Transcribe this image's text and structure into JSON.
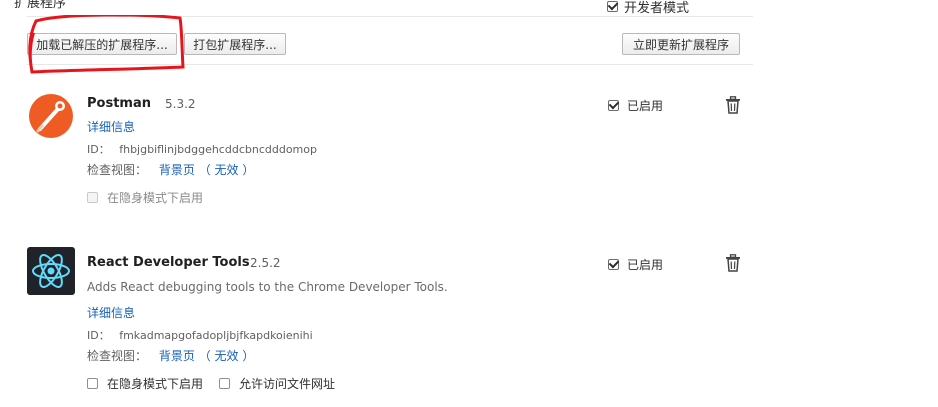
{
  "header": {
    "title": "扩展程序",
    "developer_mode_label": "开发者模式",
    "developer_mode_checked": true
  },
  "toolbar": {
    "load_unpacked_label": "加载已解压的扩展程序...",
    "pack_label": "打包扩展程序...",
    "update_label": "立即更新扩展程序"
  },
  "colors": {
    "annotation": "#e8141b",
    "link": "#1560bd",
    "react_bg": "#20232a",
    "react_atom": "#61dafb",
    "postman_orange": "#ef5b25"
  },
  "extensions": [
    {
      "name": "Postman",
      "version": "5.3.2",
      "icon": "postman-icon",
      "description": "",
      "details_label": "详细信息",
      "id_label": "ID：",
      "id_value": "fhbjgbiflinjbdggehcddcbncdddomop",
      "inspect_label": "检查视图：",
      "inspect_link": "背景页",
      "inspect_status": "（ 无效 ）",
      "incognito_label": "在隐身模式下启用",
      "incognito_disabled": true,
      "enabled_label": "已启用",
      "enabled": true
    },
    {
      "name": "React Developer Tools",
      "version": "2.5.2",
      "icon": "react-icon",
      "description": "Adds React debugging tools to the Chrome Developer Tools.",
      "details_label": "详细信息",
      "id_label": "ID：",
      "id_value": "fmkadmapgofadopljbjfkapdkoienihi",
      "inspect_label": "检查视图：",
      "inspect_link": "背景页",
      "inspect_status": "（ 无效 ）",
      "incognito_label": "在隐身模式下启用",
      "file_access_label": "允许访问文件网址",
      "enabled_label": "已启用",
      "enabled": true
    }
  ]
}
